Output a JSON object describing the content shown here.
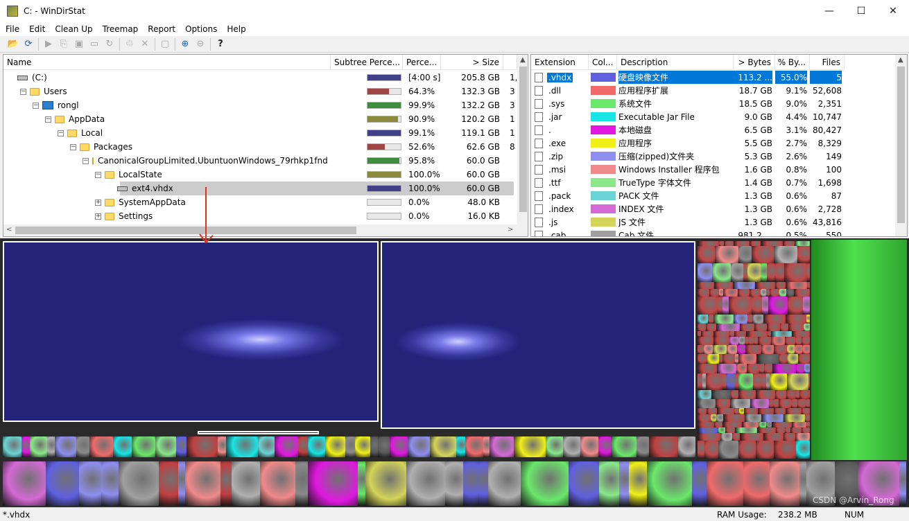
{
  "window": {
    "title": "C: - WinDirStat",
    "min_glyph": "—",
    "max_glyph": "☐",
    "close_glyph": "✕"
  },
  "menu": [
    "File",
    "Edit",
    "Clean Up",
    "Treemap",
    "Report",
    "Options",
    "Help"
  ],
  "toolbar": {
    "open": "📂",
    "refresh": "⟳",
    "go": "▶",
    "copy": "⎘",
    "explorer": "▣",
    "cmd": "▭",
    "refresh_sel": "↻",
    "recycle": "♲",
    "delete": "✕",
    "props": "▢",
    "zoom_in": "⊕",
    "zoom_out": "⊖",
    "help": "?"
  },
  "tree": {
    "headers": [
      "Name",
      "Subtree Perce...",
      "Perce...",
      "> Size",
      ""
    ],
    "rows": [
      {
        "name": "(C:)",
        "pct": "[4:00 s]",
        "size": "205.8 GB",
        "extra": "1,",
        "fill": 1.0,
        "color": "#404088"
      },
      {
        "name": "Users",
        "pct": "64.3%",
        "size": "132.3 GB",
        "extra": "3",
        "fill": 0.643,
        "color": "#a04545"
      },
      {
        "name": "rongl",
        "pct": "99.9%",
        "size": "132.2 GB",
        "extra": "3",
        "fill": 0.999,
        "color": "#3e8e3e"
      },
      {
        "name": "AppData",
        "pct": "90.9%",
        "size": "120.2 GB",
        "extra": "1",
        "fill": 0.909,
        "color": "#8a8a3a"
      },
      {
        "name": "Local",
        "pct": "99.1%",
        "size": "119.1 GB",
        "extra": "1",
        "fill": 0.991,
        "color": "#404088"
      },
      {
        "name": "Packages",
        "pct": "52.6%",
        "size": "62.6 GB",
        "extra": "8",
        "fill": 0.526,
        "color": "#a04545"
      },
      {
        "name": "CanonicalGroupLimited.UbuntuonWindows_79rhkp1fnd...",
        "pct": "95.8%",
        "size": "60.0 GB",
        "extra": "",
        "fill": 0.958,
        "color": "#3e8e3e"
      },
      {
        "name": "LocalState",
        "pct": "100.0%",
        "size": "60.0 GB",
        "extra": "",
        "fill": 1.0,
        "color": "#8a8a3a"
      },
      {
        "name": "ext4.vhdx",
        "pct": "100.0%",
        "size": "60.0 GB",
        "extra": "",
        "fill": 1.0,
        "color": "#404088"
      },
      {
        "name": "SystemAppData",
        "pct": "0.0%",
        "size": "48.0 KB",
        "extra": "",
        "fill": 0.0,
        "color": "#a04545"
      },
      {
        "name": "Settings",
        "pct": "0.0%",
        "size": "16.0 KB",
        "extra": "",
        "fill": 0.0,
        "color": "#3e8e3e"
      }
    ]
  },
  "extensions": {
    "headers": [
      "Extension",
      "Col...",
      "Description",
      "> Bytes",
      "% By...",
      "Files"
    ],
    "rows": [
      {
        "ext": ".vhdx",
        "color": "#6060e0",
        "desc": "硬盘映像文件",
        "bytes": "113.2 ...",
        "pct": "55.0%",
        "files": "5"
      },
      {
        "ext": ".dll",
        "color": "#f06a6a",
        "desc": "应用程序扩展",
        "bytes": "18.7 GB",
        "pct": "9.1%",
        "files": "52,608"
      },
      {
        "ext": ".sys",
        "color": "#6ae86a",
        "desc": "系统文件",
        "bytes": "18.5 GB",
        "pct": "9.0%",
        "files": "2,351"
      },
      {
        "ext": ".jar",
        "color": "#18e6e6",
        "desc": "Executable Jar File",
        "bytes": "9.0 GB",
        "pct": "4.4%",
        "files": "10,747"
      },
      {
        "ext": ".",
        "color": "#e018e0",
        "desc": "本地磁盘",
        "bytes": "6.5 GB",
        "pct": "3.1%",
        "files": "80,427"
      },
      {
        "ext": ".exe",
        "color": "#f0f018",
        "desc": "应用程序",
        "bytes": "5.5 GB",
        "pct": "2.7%",
        "files": "8,329"
      },
      {
        "ext": ".zip",
        "color": "#8e8ef0",
        "desc": "压缩(zipped)文件夹",
        "bytes": "5.3 GB",
        "pct": "2.6%",
        "files": "149"
      },
      {
        "ext": ".msi",
        "color": "#f08a8a",
        "desc": "Windows Installer 程序包",
        "bytes": "1.6 GB",
        "pct": "0.8%",
        "files": "100"
      },
      {
        "ext": ".ttf",
        "color": "#8ae88a",
        "desc": "TrueType 字体文件",
        "bytes": "1.4 GB",
        "pct": "0.7%",
        "files": "1,698"
      },
      {
        "ext": ".pack",
        "color": "#6ad4d4",
        "desc": "PACK 文件",
        "bytes": "1.3 GB",
        "pct": "0.6%",
        "files": "87"
      },
      {
        "ext": ".index",
        "color": "#d46ad4",
        "desc": "INDEX 文件",
        "bytes": "1.3 GB",
        "pct": "0.6%",
        "files": "2,728"
      },
      {
        "ext": ".js",
        "color": "#d4d45a",
        "desc": "JS 文件",
        "bytes": "1.3 GB",
        "pct": "0.6%",
        "files": "43,816"
      },
      {
        "ext": ".cab",
        "color": "#a0a0a0",
        "desc": "Cab 文件",
        "bytes": "981.2 ...",
        "pct": "0.5%",
        "files": "550"
      }
    ]
  },
  "status": {
    "filter": "*.vhdx",
    "ram_label": "RAM Usage:",
    "ram_value": "238.2 MB",
    "num": "NUM",
    "watermark": "CSDN @Arvin_Rong"
  },
  "colors": {
    "selection": "#0078d7",
    "treemap_bg": "#2a2a2a",
    "vhdx_blue": "#3a3aa0",
    "annotation_red": "#e03020"
  }
}
